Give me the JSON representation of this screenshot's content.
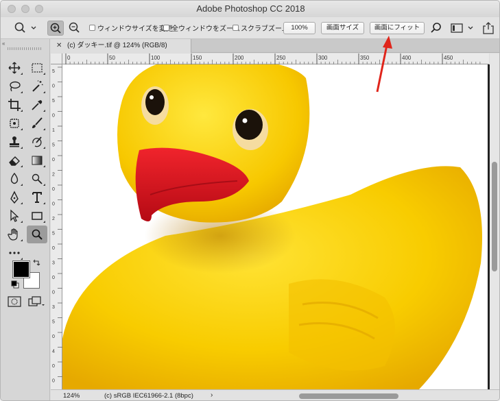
{
  "window": {
    "title": "Adobe Photoshop CC 2018"
  },
  "options_bar": {
    "resize_windows_label": "ウィンドウサイズを変更",
    "zoom_all_windows_label": "全ウィンドウをズーム",
    "scrubby_zoom_label": "スクラブズーム",
    "btn_100": "100%",
    "btn_fit_screen": "画面サイズ",
    "btn_fill_screen": "画面にフィット"
  },
  "document": {
    "tab_title": "(c) ダッキー.tif @ 124% (RGB/8)",
    "zoom_level": "124%",
    "color_profile": "(c) sRGB IEC61966-2.1 (8bpc)"
  },
  "ruler": {
    "h_ticks": [
      "0",
      "50",
      "100",
      "150",
      "200",
      "250",
      "300",
      "350",
      "400",
      "450"
    ],
    "v_ticks": [
      "5",
      "0",
      "5",
      "0",
      "1",
      "5",
      "0",
      "2",
      "0",
      "0",
      "2",
      "5",
      "0",
      "3",
      "0",
      "0",
      "3",
      "5",
      "0",
      "4",
      "0",
      "0"
    ]
  },
  "colors": {
    "duck_yellow": "#f6c800",
    "beak_red": "#d8101c",
    "annotation_arrow": "#e0251b"
  }
}
